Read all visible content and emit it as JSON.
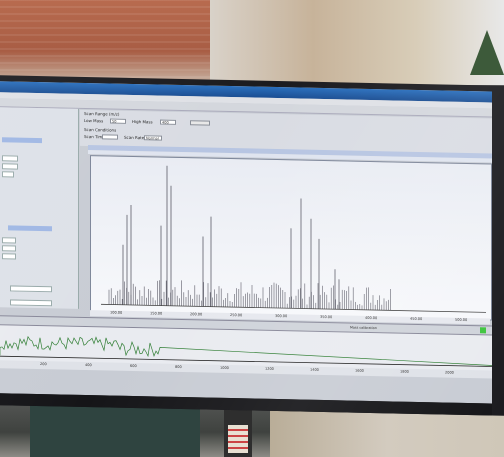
{
  "app": {
    "title": "",
    "menu": []
  },
  "settings": {
    "scan_range_label": "Scan Range (m/z)",
    "low_mass_label": "Low Mass",
    "low_mass_value": "50",
    "high_mass_label": "High Mass",
    "high_mass_value": "400",
    "scan_conditions_label": "Scan Conditions",
    "scan_time_label": "Scan Time",
    "scan_rate_label": "Scan Rate",
    "scan_rate_value": "Normal"
  },
  "spectrum": {
    "x_ticks": [
      "100.00",
      "150.00",
      "200.00",
      "250.00",
      "300.00",
      "350.00",
      "400.00",
      "450.00",
      "500.00"
    ]
  },
  "status": {
    "left": "",
    "middle": "",
    "right": "Mass calibration"
  },
  "tic": {
    "time_ticks": [
      "200",
      "400",
      "600",
      "800",
      "1000",
      "1200",
      "1400",
      "1600",
      "1800",
      "2000"
    ]
  },
  "colors": {
    "titlebar": "#2a6fbd",
    "plot_bg": "#eef0f5",
    "peaks": "#5a5a66",
    "tic": "#2e7d32"
  }
}
